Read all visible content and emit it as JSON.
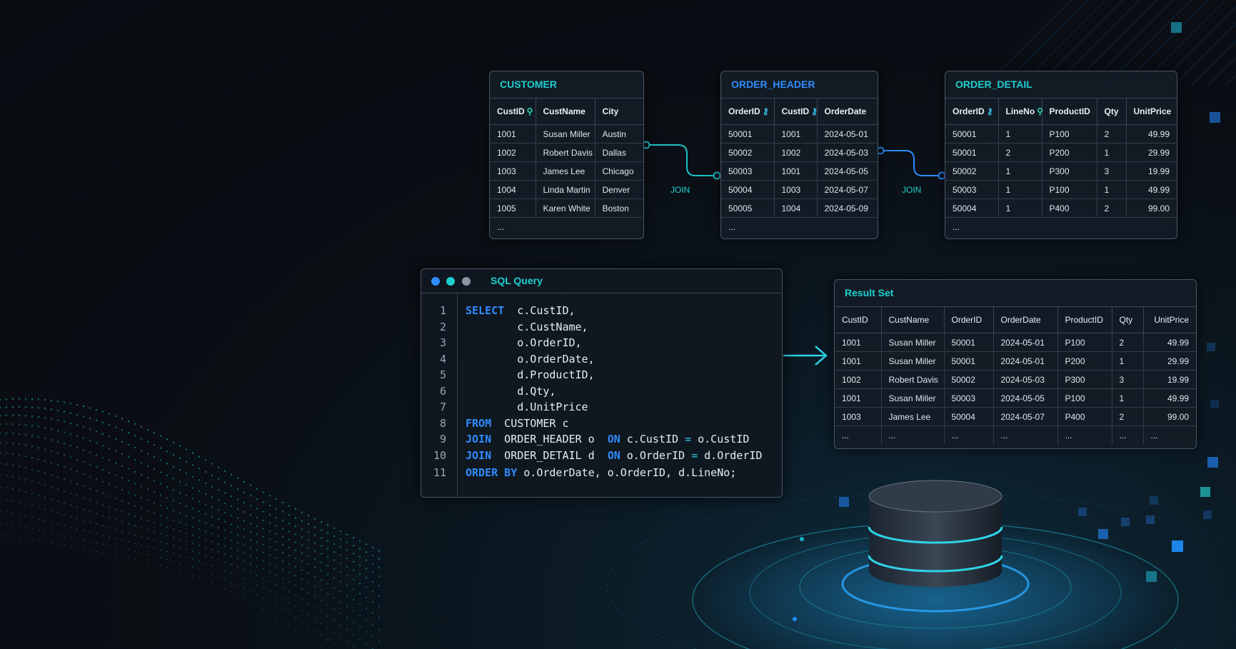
{
  "colors": {
    "cyan": "#1fd0d0",
    "blue": "#2f8dff",
    "background": "#0a0f15"
  },
  "customer": {
    "title": "CUSTOMER",
    "headers": [
      "CustID",
      "CustName",
      "City"
    ],
    "rows": [
      [
        "1001",
        "Susan Miller",
        "Austin"
      ],
      [
        "1002",
        "Robert Davis",
        "Dallas"
      ],
      [
        "1003",
        "James Lee",
        "Chicago"
      ],
      [
        "1004",
        "Linda Martin",
        "Denver"
      ],
      [
        "1005",
        "Karen White",
        "Boston"
      ]
    ],
    "ellipsis": "..."
  },
  "order_header": {
    "title": "ORDER_HEADER",
    "headers": [
      "OrderID",
      "CustID",
      "OrderDate"
    ],
    "rows": [
      [
        "50001",
        "1001",
        "2024-05-01"
      ],
      [
        "50002",
        "1002",
        "2024-05-03"
      ],
      [
        "50003",
        "1001",
        "2024-05-05"
      ],
      [
        "50004",
        "1003",
        "2024-05-07"
      ],
      [
        "50005",
        "1004",
        "2024-05-09"
      ]
    ],
    "ellipsis": "..."
  },
  "order_detail": {
    "title": "ORDER_DETAIL",
    "headers": [
      "OrderID",
      "LineNo",
      "ProductID",
      "Qty",
      "UnitPrice"
    ],
    "rows": [
      [
        "50001",
        "1",
        "P100",
        "2",
        "49.99"
      ],
      [
        "50001",
        "2",
        "P200",
        "1",
        "29.99"
      ],
      [
        "50002",
        "1",
        "P300",
        "3",
        "19.99"
      ],
      [
        "50003",
        "1",
        "P100",
        "1",
        "49.99"
      ],
      [
        "50004",
        "1",
        "P400",
        "2",
        "99.00"
      ]
    ],
    "ellipsis": "..."
  },
  "joins": [
    "JOIN",
    "JOIN"
  ],
  "sql_window": {
    "title": "SQL Query",
    "line_numbers": [
      "1",
      "2",
      "3",
      "4",
      "5",
      "6",
      "7",
      "8",
      "9",
      "10",
      "11"
    ]
  },
  "result_set": {
    "title": "Result Set",
    "headers": [
      "CustID",
      "CustName",
      "OrderID",
      "OrderDate",
      "ProductID",
      "Qty",
      "UnitPrice"
    ],
    "rows": [
      [
        "1001",
        "Susan Miller",
        "50001",
        "2024-05-01",
        "P100",
        "2",
        "49.99"
      ],
      [
        "1001",
        "Susan Miller",
        "50001",
        "2024-05-01",
        "P200",
        "1",
        "29.99"
      ],
      [
        "1002",
        "Robert Davis",
        "50002",
        "2024-05-03",
        "P300",
        "3",
        "19.99"
      ],
      [
        "1001",
        "Susan Miller",
        "50003",
        "2024-05-05",
        "P100",
        "1",
        "49.99"
      ],
      [
        "1003",
        "James Lee",
        "50004",
        "2024-05-07",
        "P400",
        "2",
        "99.00"
      ]
    ],
    "ellipsis": [
      "...",
      "...",
      "...",
      "...",
      "...",
      "...",
      "..."
    ]
  }
}
